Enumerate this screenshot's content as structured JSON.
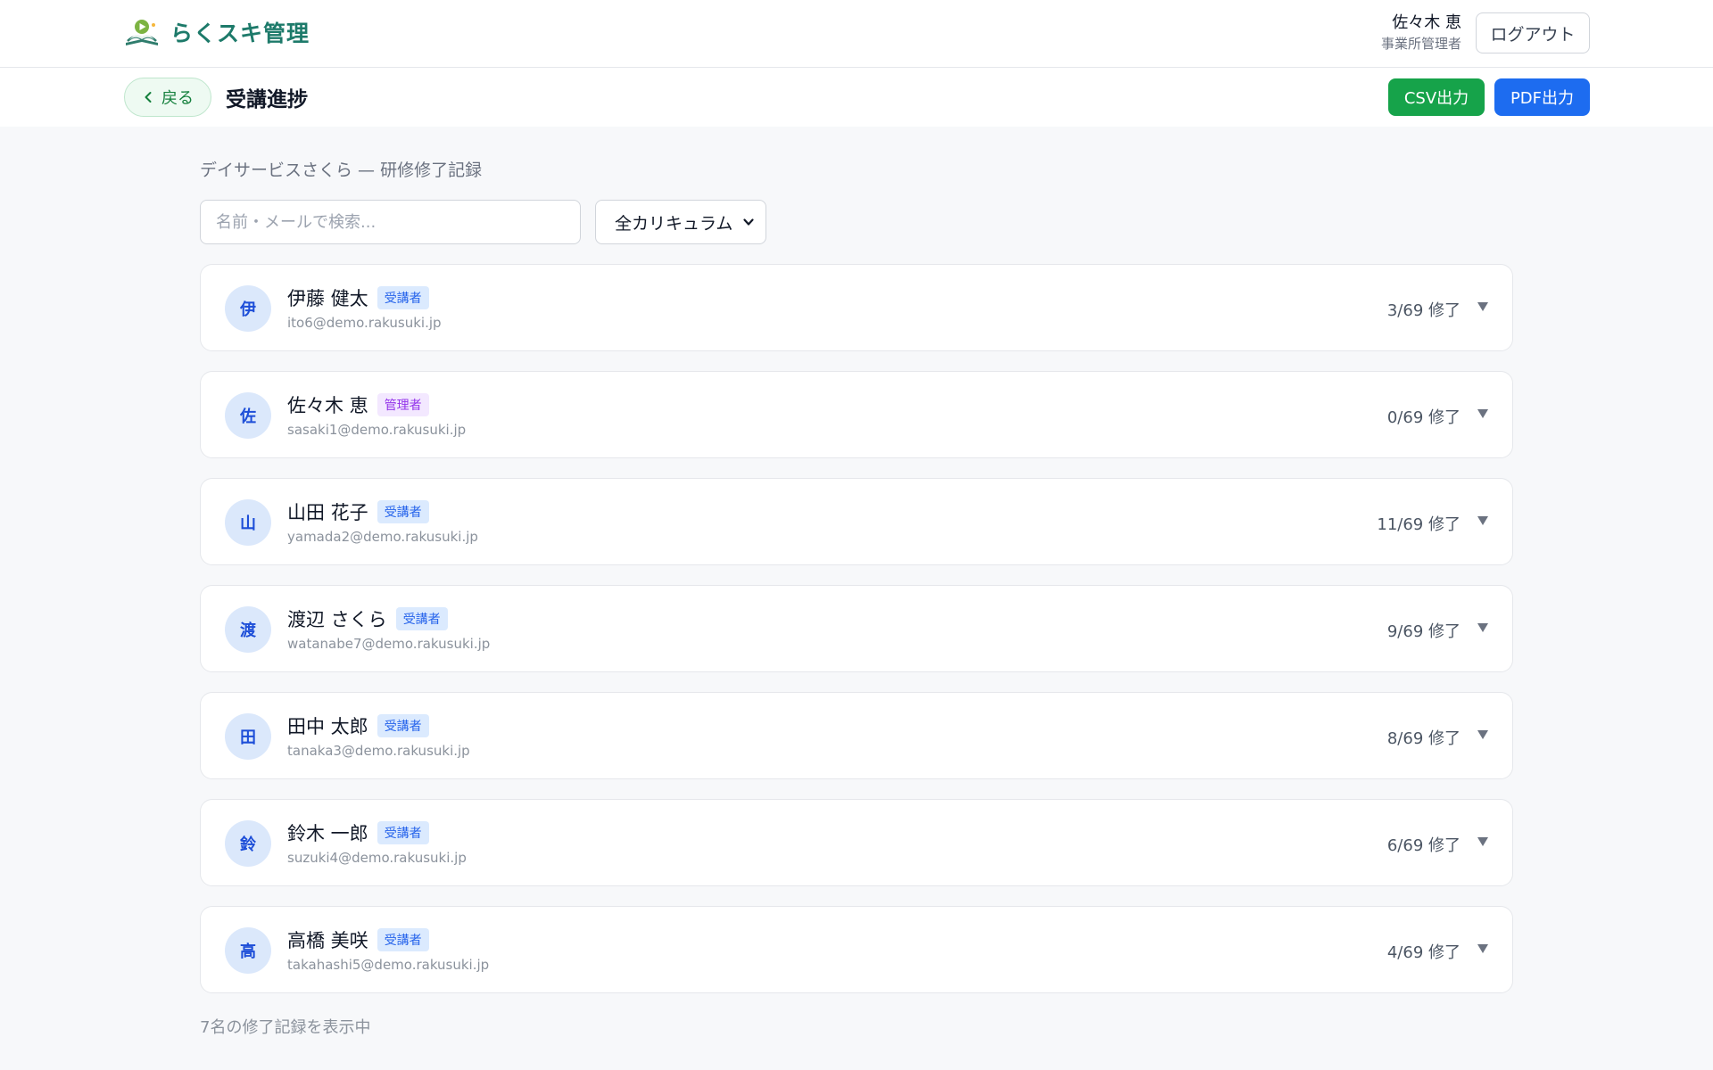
{
  "app": {
    "name": "らくスキ管理"
  },
  "user": {
    "name": "佐々木 恵",
    "role": "事業所管理者",
    "logout_label": "ログアウト"
  },
  "subheader": {
    "back_label": "戻る",
    "title": "受講進捗",
    "csv_label": "CSV出力",
    "pdf_label": "PDF出力"
  },
  "filters": {
    "org_label": "デイサービスさくら — 研修修了記録",
    "search_placeholder": "名前・メールで検索...",
    "search_value": "",
    "curriculum_selected": "全カリキュラム"
  },
  "members": [
    {
      "initial": "伊",
      "name": "伊藤 健太",
      "role": "受講者",
      "role_type": "learner",
      "email": "ito6@demo.rakusuki.jp",
      "progress": "3/69 修了"
    },
    {
      "initial": "佐",
      "name": "佐々木 恵",
      "role": "管理者",
      "role_type": "admin",
      "email": "sasaki1@demo.rakusuki.jp",
      "progress": "0/69 修了"
    },
    {
      "initial": "山",
      "name": "山田 花子",
      "role": "受講者",
      "role_type": "learner",
      "email": "yamada2@demo.rakusuki.jp",
      "progress": "11/69 修了"
    },
    {
      "initial": "渡",
      "name": "渡辺 さくら",
      "role": "受講者",
      "role_type": "learner",
      "email": "watanabe7@demo.rakusuki.jp",
      "progress": "9/69 修了"
    },
    {
      "initial": "田",
      "name": "田中 太郎",
      "role": "受講者",
      "role_type": "learner",
      "email": "tanaka3@demo.rakusuki.jp",
      "progress": "8/69 修了"
    },
    {
      "initial": "鈴",
      "name": "鈴木 一郎",
      "role": "受講者",
      "role_type": "learner",
      "email": "suzuki4@demo.rakusuki.jp",
      "progress": "6/69 修了"
    },
    {
      "initial": "高",
      "name": "高橋 美咲",
      "role": "受講者",
      "role_type": "learner",
      "email": "takahashi5@demo.rakusuki.jp",
      "progress": "4/69 修了"
    }
  ],
  "footer": {
    "count_text": "7名の修了記録を表示中"
  }
}
